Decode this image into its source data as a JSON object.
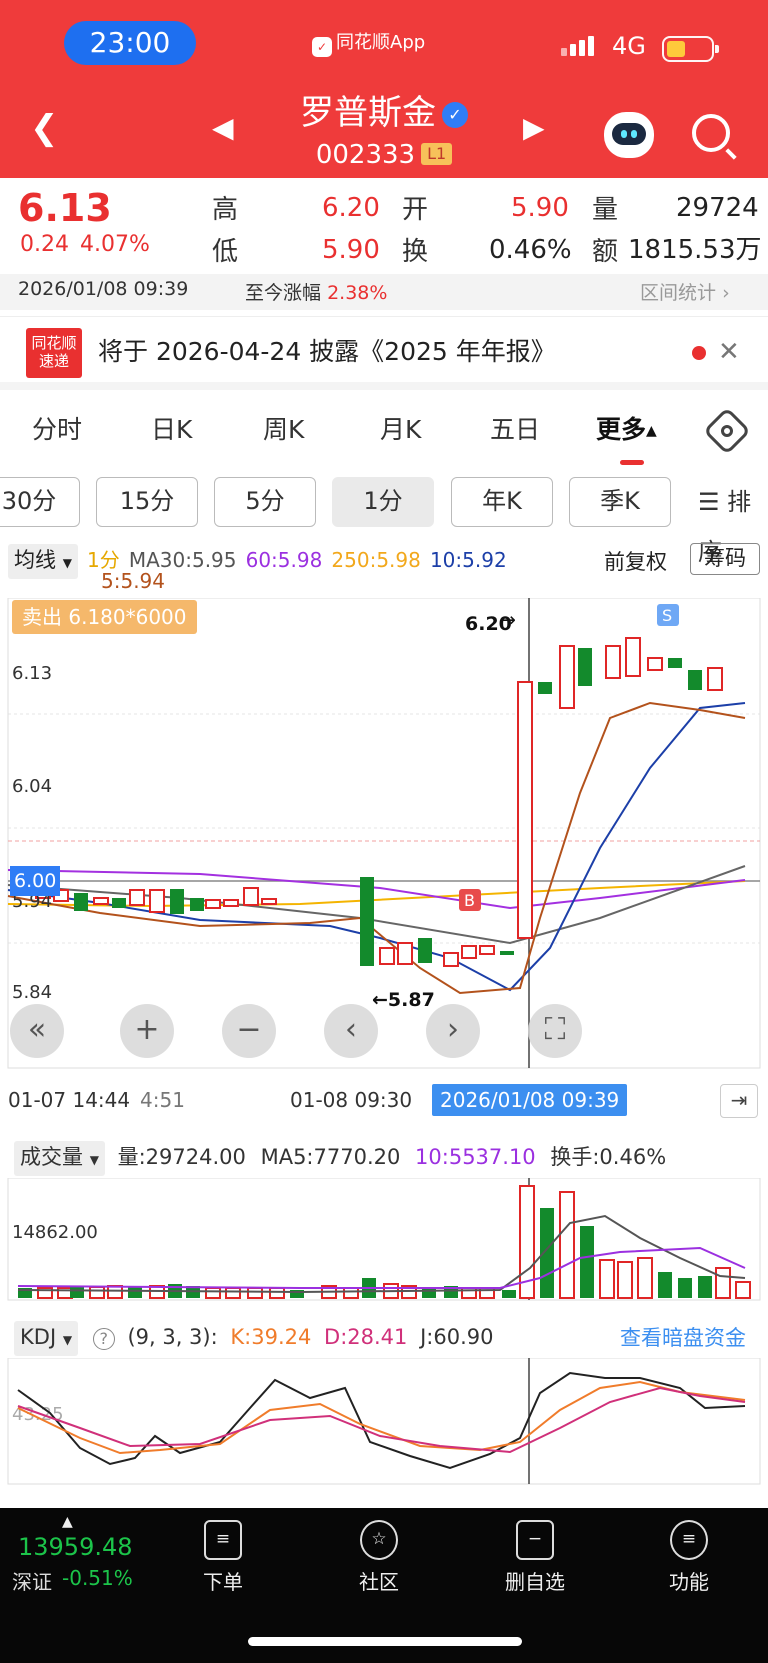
{
  "status": {
    "time": "23:00",
    "app": "同花顺App",
    "network": "4G"
  },
  "header": {
    "name": "罗普斯金",
    "code": "002333",
    "level": "L1"
  },
  "quote": {
    "price": "6.13",
    "change": "0.24",
    "pct": "4.07%",
    "high_label": "高",
    "high": "6.20",
    "low_label": "低",
    "low": "5.90",
    "open_label": "开",
    "open": "5.90",
    "turn_label": "换",
    "turn": "0.46%",
    "vol_label": "量",
    "vol": "29724",
    "amt_label": "额",
    "amt": "1815.53万"
  },
  "stats": {
    "datetime": "2026/01/08 09:39",
    "gain_label": "至今涨幅",
    "gain": "2.38%",
    "range": "区间统计"
  },
  "news": {
    "logo1": "同花顺",
    "logo2": "速递",
    "text": "将于 2026-04-24 披露《2025 年年报》"
  },
  "tabs": [
    "分时",
    "日K",
    "周K",
    "月K",
    "五日",
    "更多"
  ],
  "periods": [
    "30分",
    "15分",
    "5分",
    "1分",
    "年K",
    "季K"
  ],
  "sort_label": "排序",
  "legend": {
    "type": "均线",
    "period": "1分",
    "ma30": "MA30:5.95",
    "ma60": "60:5.98",
    "ma250": "250:5.98",
    "ma10": "10:5.92",
    "ma5": "5:5.94",
    "fq": "前复权",
    "chip": "筹码"
  },
  "chart": {
    "sell_badge": "卖出 6.180*6000",
    "high_mark": "6.20",
    "low_mark": "←5.87",
    "yticks": [
      "6.13",
      "6.04",
      "6.00",
      "5.94",
      "5.84"
    ],
    "b_mark": "B",
    "s_mark": "S"
  },
  "xaxis": {
    "t1": "01-07 14:44",
    "t2": "4:51",
    "t3": "01-08 09:30",
    "selected": "2026/01/08 09:39"
  },
  "volume": {
    "label": "成交量",
    "vol": "量:29724.00",
    "ma5": "MA5:7770.20",
    "ma10": "10:5537.10",
    "turn": "换手:0.46%",
    "ytick": "14862.00"
  },
  "kdj": {
    "label": "KDJ",
    "params": "(9, 3, 3):",
    "k": "K:39.24",
    "d": "D:28.41",
    "j": "J:60.90",
    "ytick": "43.25",
    "hint": "查看暗盘资金"
  },
  "bottom": {
    "index_value": "13959.48",
    "index_name": "深证",
    "index_change": "-0.51%",
    "nav": [
      "下单",
      "社区",
      "删自选",
      "功能"
    ]
  }
}
